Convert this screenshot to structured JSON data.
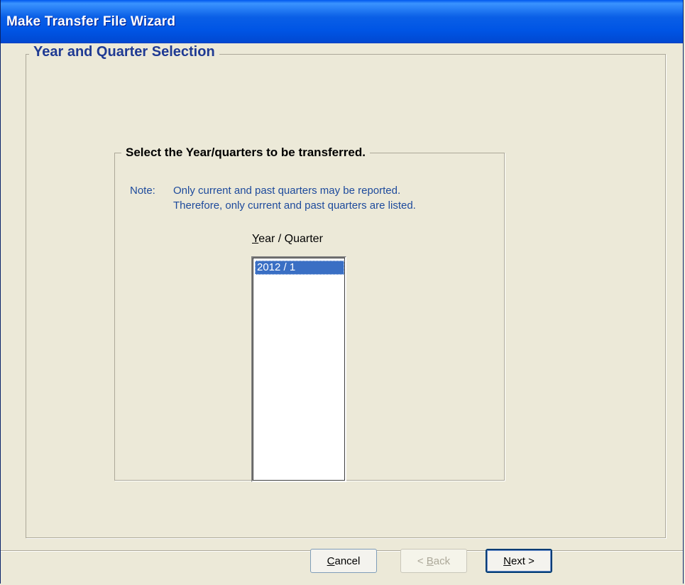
{
  "window": {
    "title": "Make Transfer File Wizard"
  },
  "outer_group": {
    "legend": "Year and Quarter Selection"
  },
  "inner_group": {
    "legend": "Select the Year/quarters to be transferred.",
    "note_label": "Note:",
    "note_line1": "Only current and past quarters may be reported.",
    "note_line2": "Therefore, only current and past quarters are listed."
  },
  "list": {
    "label_mnemonic": "Y",
    "label_rest": "ear / Quarter",
    "items": [
      "2012 / 1"
    ],
    "selected_index": 0
  },
  "buttons": {
    "cancel_mnemonic": "C",
    "cancel_rest": "ancel",
    "back_prefix": "< ",
    "back_mnemonic": "B",
    "back_rest": "ack",
    "next_mnemonic": "N",
    "next_rest": "ext >",
    "back_enabled": false
  },
  "colors": {
    "title_bar": "#0055e5",
    "dialog_bg": "#ece9d8",
    "selection": "#3a6fc4",
    "note_text": "#1d4a9c"
  }
}
